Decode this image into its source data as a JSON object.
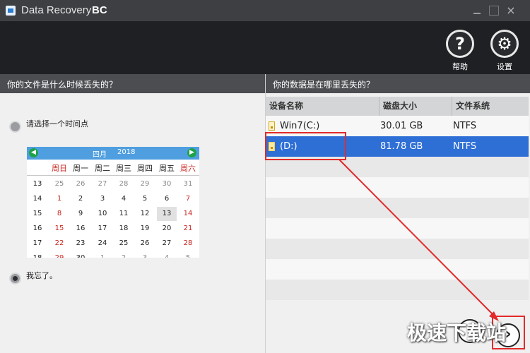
{
  "window": {
    "title": "Data Recovery",
    "title_suffix": "BC",
    "close_glyph": "×"
  },
  "toolbar": {
    "help_label": "帮助",
    "help_glyph": "?",
    "settings_label": "设置",
    "settings_glyph": "⚙"
  },
  "left": {
    "heading": "你的文件是什么时候丢失的？",
    "option_time": "请选择一个时间点",
    "option_forgot": "我忘了。"
  },
  "calendar": {
    "month": "四月",
    "year": "2018",
    "weekdays": [
      "周日",
      "周一",
      "周二",
      "周三",
      "周四",
      "周五",
      "周六"
    ],
    "rows": [
      [
        "13",
        "25",
        "26",
        "27",
        "28",
        "29",
        "30",
        "31"
      ],
      [
        "14",
        "1",
        "2",
        "3",
        "4",
        "5",
        "6",
        "7"
      ],
      [
        "15",
        "8",
        "9",
        "10",
        "11",
        "12",
        "13",
        "14"
      ],
      [
        "16",
        "15",
        "16",
        "17",
        "18",
        "19",
        "20",
        "21"
      ],
      [
        "17",
        "22",
        "23",
        "24",
        "25",
        "26",
        "27",
        "28"
      ],
      [
        "18",
        "29",
        "30",
        "1",
        "2",
        "3",
        "4",
        "5"
      ]
    ],
    "selected_day": "13"
  },
  "right": {
    "heading": "你的数据是在哪里丢失的？",
    "columns": [
      "设备名称",
      "磁盘大小",
      "文件系统"
    ],
    "drives": [
      {
        "name": "Win7(C:)",
        "size": "30.01 GB",
        "fs": "NTFS"
      },
      {
        "name": "(D:)",
        "size": "81.78 GB",
        "fs": "NTFS"
      }
    ]
  },
  "nav": {
    "back_glyph": "‹",
    "next_glyph": "›"
  },
  "watermark": "极速下载站",
  "colors": {
    "accent": "#2e6fd6",
    "highlight": "#e22a2a",
    "weekend": "#c8251e"
  }
}
